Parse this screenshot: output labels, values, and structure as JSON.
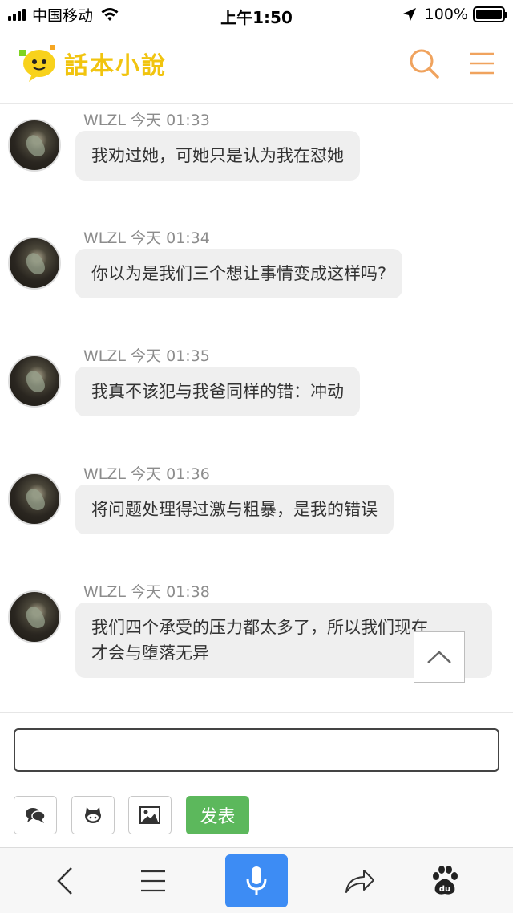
{
  "status_bar": {
    "carrier": "中国移动",
    "time": "上午1:50",
    "battery": "100%",
    "battery_level": 1.0
  },
  "header": {
    "logo_text": "話本小說",
    "search_icon": "search-icon",
    "menu_icon": "hamburger-menu-icon"
  },
  "messages": [
    {
      "author": "WLZL",
      "time": "今天 01:33",
      "text": "我劝过她，可她只是认为我在怼她"
    },
    {
      "author": "WLZL",
      "time": "今天 01:34",
      "text": "你以为是我们三个想让事情变成这样吗?"
    },
    {
      "author": "WLZL",
      "time": "今天 01:35",
      "text": "我真不该犯与我爸同样的错：冲动"
    },
    {
      "author": "WLZL",
      "time": "今天 01:36",
      "text": "将问题处理得过激与粗暴，是我的错误"
    },
    {
      "author": "WLZL",
      "time": "今天 01:38",
      "text_line1": "我们四个承受的压力都太多了，所以我们现在",
      "text_line2": "才会与堕落无异"
    }
  ],
  "composer": {
    "input_value": "",
    "send_label": "发表",
    "tools": [
      "chat-bubbles-icon",
      "github-icon",
      "image-icon"
    ]
  },
  "colors": {
    "accent_orange": "#f0a35e",
    "send_green": "#5cb85c",
    "mic_blue": "#3d8cf4",
    "logo_yellow": "#f1c40f"
  },
  "bottom_bar": {
    "icons": [
      "back-arrow-icon",
      "menu-icon",
      "microphone-icon",
      "share-icon",
      "baidu-paw-icon"
    ]
  }
}
